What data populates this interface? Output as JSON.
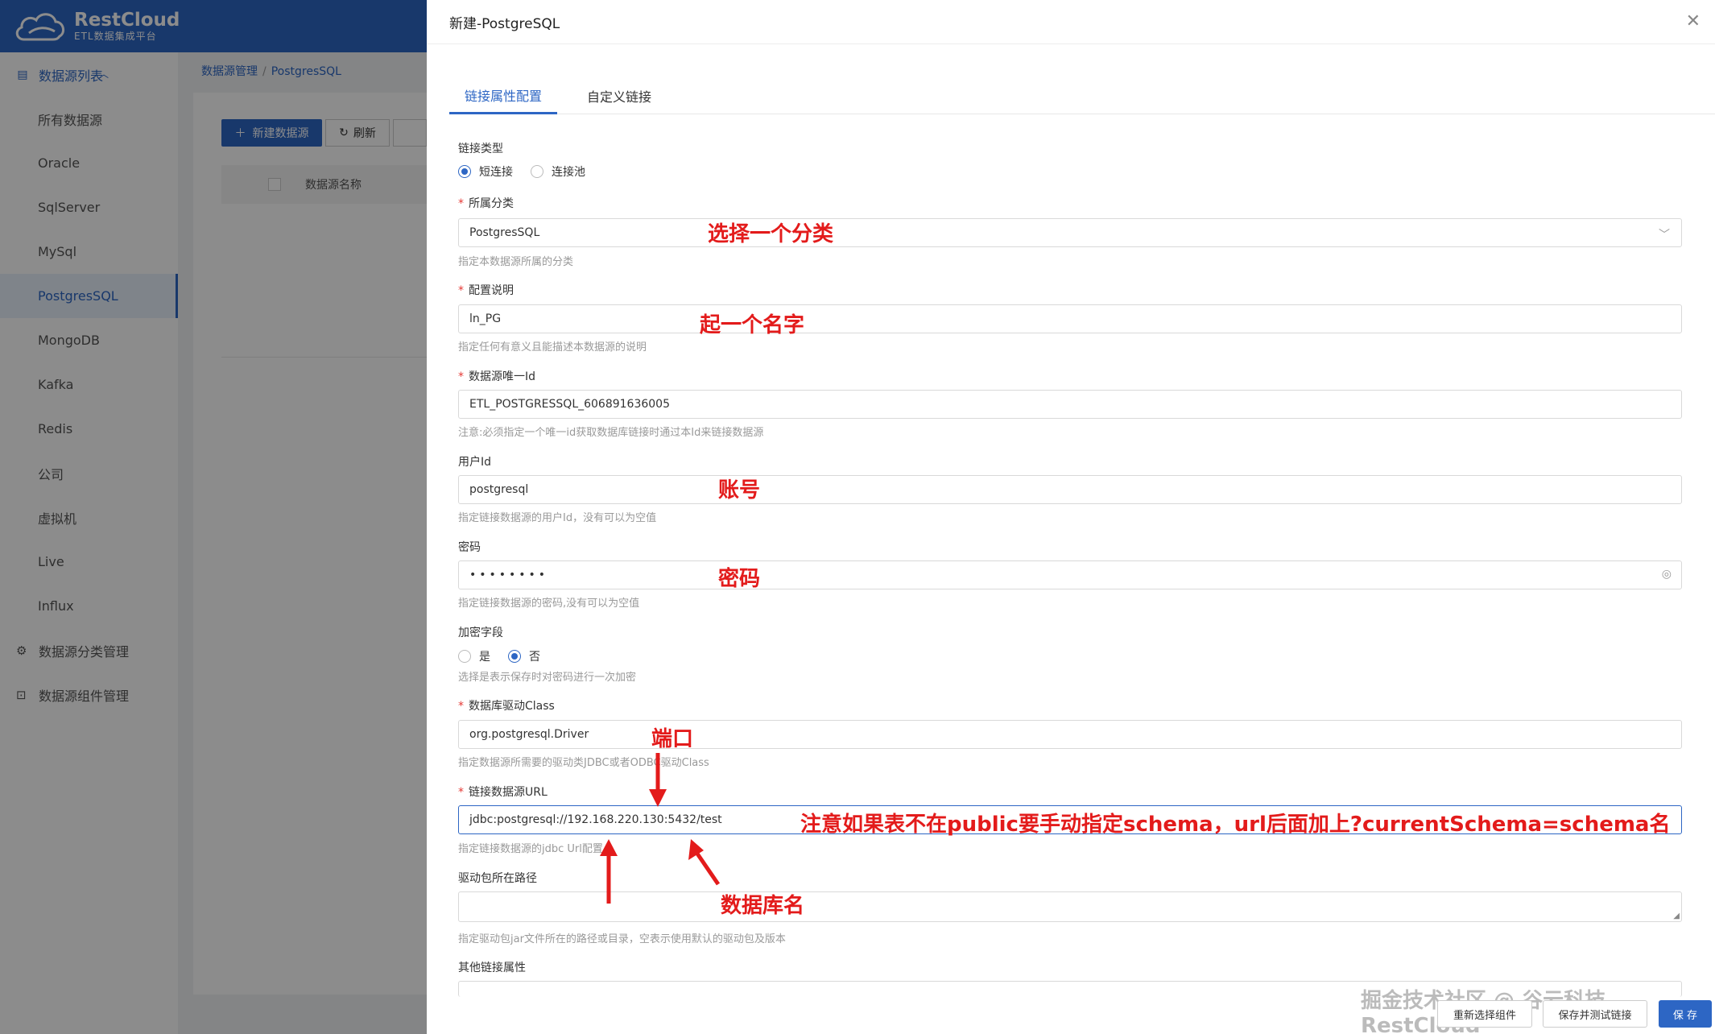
{
  "app": {
    "brand_name": "RestCloud",
    "brand_sub": "ETL数据集成平台"
  },
  "sidebar": {
    "group_label": "数据源列表",
    "items": [
      "所有数据源",
      "Oracle",
      "SqlServer",
      "MySql",
      "PostgresSQL",
      "MongoDB",
      "Kafka",
      "Redis",
      "公司",
      "虚拟机",
      "Live",
      "Influx"
    ],
    "active_item": "PostgresSQL",
    "footer_items": [
      "数据源分类管理",
      "数据源组件管理"
    ]
  },
  "breadcrumb": [
    "数据源管理",
    "PostgresSQL"
  ],
  "toolbar": {
    "new_label": "新建数据源",
    "refresh_label": "刷新"
  },
  "table": {
    "col_name": "数据源名称"
  },
  "drawer": {
    "title": "新建-PostgreSQL",
    "tabs": [
      "链接属性配置",
      "自定义链接"
    ],
    "fields": {
      "conn_type": {
        "label": "链接类型",
        "options": [
          "短连接",
          "连接池"
        ],
        "selected": "短连接"
      },
      "category": {
        "label": "所属分类",
        "value": "PostgresSQL",
        "help": "指定本数据源所属的分类"
      },
      "desc": {
        "label": "配置说明",
        "value": "ln_PG",
        "help": "指定任何有意义且能描述本数据源的说明"
      },
      "uid": {
        "label": "数据源唯一Id",
        "value": "ETL_POSTGRESSQL_606891636005",
        "help": "注意:必须指定一个唯一id获取数据库链接时通过本Id来链接数据源"
      },
      "user": {
        "label": "用户Id",
        "value": "postgresql",
        "help": "指定链接数据源的用户Id，没有可以为空值"
      },
      "password": {
        "label": "密码",
        "value": "••••••••",
        "help": "指定链接数据源的密码,没有可以为空值"
      },
      "encrypt": {
        "label": "加密字段",
        "options": [
          "是",
          "否"
        ],
        "selected": "否",
        "help": "选择是表示保存时对密码进行一次加密"
      },
      "driver": {
        "label": "数据库驱动Class",
        "value": "org.postgresql.Driver",
        "help": "指定数据源所需要的驱动类JDBC或者ODBC驱动Class"
      },
      "url": {
        "label": "链接数据源URL",
        "value": "jdbc:postgresql://192.168.220.130:5432/test",
        "help": "指定链接数据源的jdbc Url配置"
      },
      "jar_path": {
        "label": "驱动包所在路径",
        "value": "",
        "help": "指定驱动包jar文件所在的路径或目录，空表示使用默认的驱动包及版本"
      },
      "other": {
        "label": "其他链接属性"
      }
    },
    "buttons": {
      "reselect": "重新选择组件",
      "save_test": "保存并测试链接",
      "save": "保 存"
    }
  },
  "annotations": {
    "category": "选择一个分类",
    "name": "起一个名字",
    "account": "账号",
    "password": "密码",
    "port": "端口",
    "schema_note": "注意如果表不在public要手动指定schema，url后面加上?currentSchema=schema名",
    "dbname": "数据库名"
  },
  "watermark": "掘金技术社区 @ 谷云科技RestCloud",
  "colors": {
    "primary": "#2d66c4",
    "annotation": "#e31b1b"
  }
}
